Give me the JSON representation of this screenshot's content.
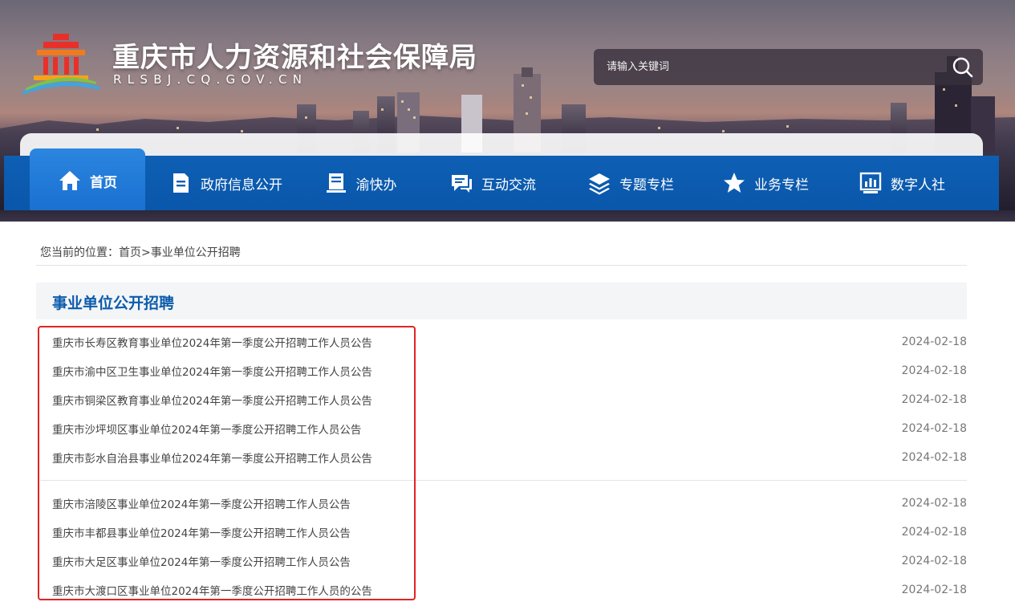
{
  "site": {
    "title": "重庆市人力资源和社会保障局",
    "domain": "RLSBJ.CQ.GOV.CN"
  },
  "search": {
    "placeholder": "请输入关键词",
    "button_icon": "search-icon"
  },
  "nav": {
    "items": [
      {
        "label": "首页",
        "icon": "home-icon",
        "active": true
      },
      {
        "label": "政府信息公开",
        "icon": "document-icon"
      },
      {
        "label": "渝快办",
        "icon": "book-icon"
      },
      {
        "label": "互动交流",
        "icon": "chat-icon"
      },
      {
        "label": "专题专栏",
        "icon": "layers-icon"
      },
      {
        "label": "业务专栏",
        "icon": "star-icon"
      },
      {
        "label": "数字人社",
        "icon": "chart-icon"
      }
    ]
  },
  "breadcrumb": {
    "prefix": "您当前的位置：",
    "home": "首页",
    "separator": ">",
    "current": "事业单位公开招聘"
  },
  "section": {
    "title": "事业单位公开招聘"
  },
  "articles": [
    {
      "title": "重庆市长寿区教育事业单位2024年第一季度公开招聘工作人员公告",
      "date": "2024-02-18"
    },
    {
      "title": "重庆市渝中区卫生事业单位2024年第一季度公开招聘工作人员公告",
      "date": "2024-02-18"
    },
    {
      "title": "重庆市铜梁区教育事业单位2024年第一季度公开招聘工作人员公告",
      "date": "2024-02-18"
    },
    {
      "title": "重庆市沙坪坝区事业单位2024年第一季度公开招聘工作人员公告",
      "date": "2024-02-18"
    },
    {
      "title": "重庆市彭水自治县事业单位2024年第一季度公开招聘工作人员公告",
      "date": "2024-02-18"
    },
    {
      "title": "重庆市涪陵区事业单位2024年第一季度公开招聘工作人员公告",
      "date": "2024-02-18"
    },
    {
      "title": "重庆市丰都县事业单位2024年第一季度公开招聘工作人员公告",
      "date": "2024-02-18"
    },
    {
      "title": "重庆市大足区事业单位2024年第一季度公开招聘工作人员公告",
      "date": "2024-02-18"
    },
    {
      "title": "重庆市大渡口区事业单位2024年第一季度公开招聘工作人员的公告",
      "date": "2024-02-18"
    }
  ],
  "colors": {
    "nav_blue": "#0e5fb4",
    "nav_active": "#1a6fd0",
    "section_title": "#0b5cab",
    "highlight_red": "#e02424"
  }
}
